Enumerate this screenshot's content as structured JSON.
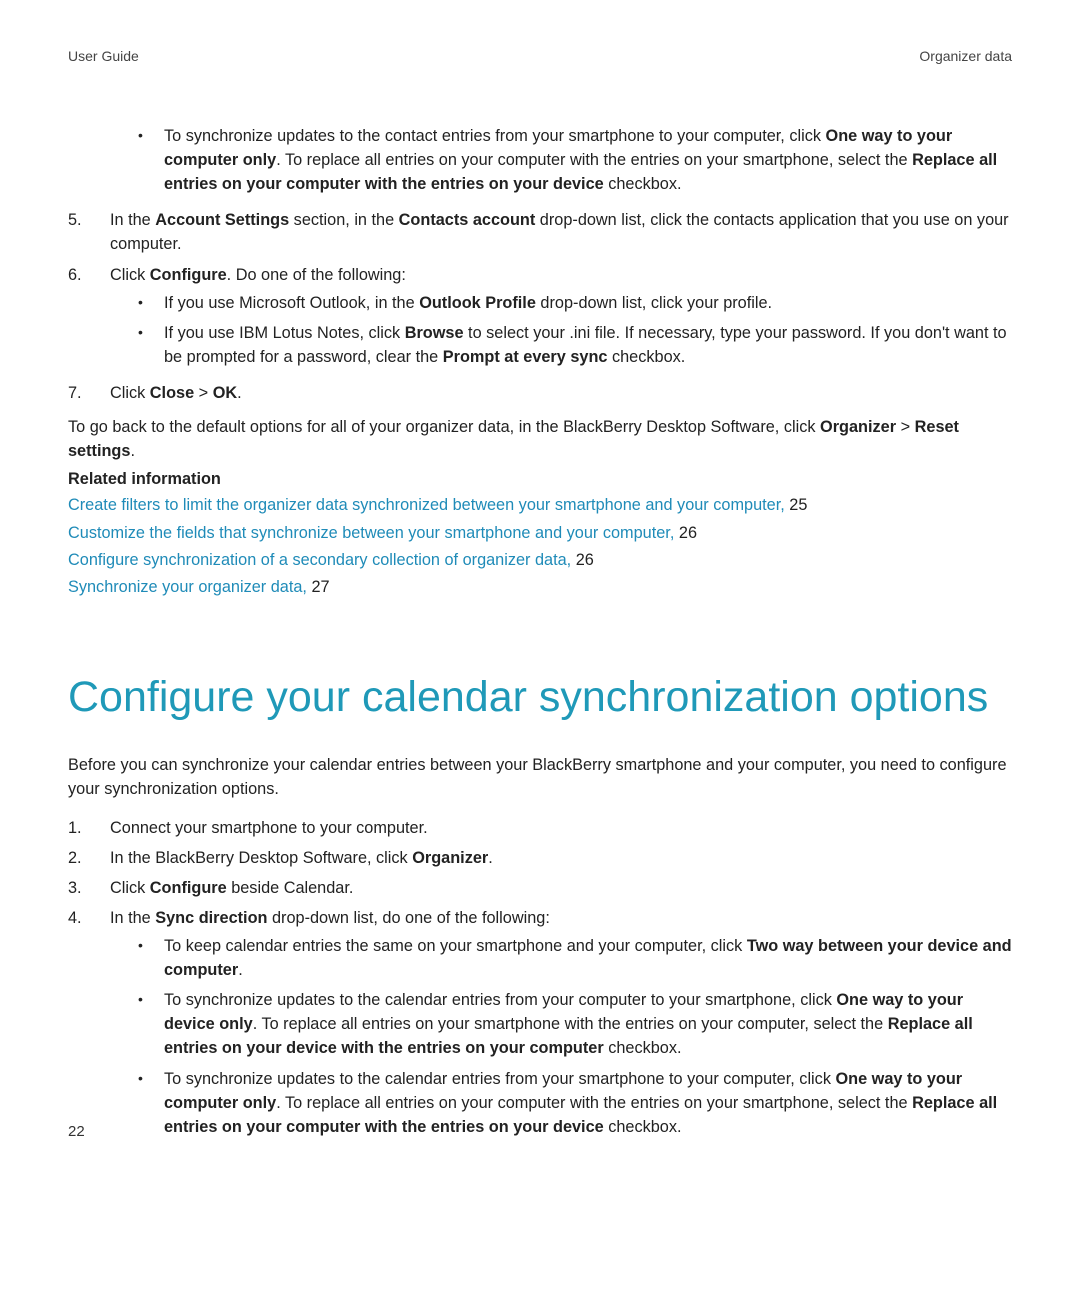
{
  "header": {
    "left": "User Guide",
    "right": "Organizer data"
  },
  "topBullet": {
    "pre": "To synchronize updates to the contact entries from your smartphone to your computer, click ",
    "b1": "One way to your computer only",
    "mid1": ". To replace all entries on your computer with the entries on your smartphone, select the ",
    "b2": "Replace all entries on your computer with the entries on your device",
    "post": " checkbox."
  },
  "step5": {
    "num": "5.",
    "pre": "In the ",
    "b1": "Account Settings",
    "mid1": " section, in the ",
    "b2": "Contacts account",
    "post": " drop-down list, click the contacts application that you use on your computer."
  },
  "step6": {
    "num": "6.",
    "pre": "Click ",
    "b1": "Configure",
    "post": ". Do one of the following:",
    "sub1": {
      "pre": "If you use Microsoft Outlook, in the ",
      "b1": "Outlook Profile",
      "post": " drop-down list, click your profile."
    },
    "sub2": {
      "pre": "If you use IBM Lotus Notes, click ",
      "b1": "Browse",
      "mid1": " to select your .ini file. If necessary, type your password. If you don't want to be prompted for a password, clear the ",
      "b2": "Prompt at every sync",
      "post": " checkbox."
    }
  },
  "step7": {
    "num": "7.",
    "pre": "Click ",
    "b1": "Close",
    "mid": " > ",
    "b2": "OK",
    "post": "."
  },
  "paraBack": {
    "pre": "To go back to the default options for all of your organizer data, in the BlackBerry Desktop Software, click ",
    "b1": "Organizer",
    "mid": " > ",
    "b2": "Reset settings",
    "post": "."
  },
  "relatedHeading": "Related information",
  "relatedLinks": [
    {
      "text": "Create filters to limit the organizer data synchronized between your smartphone and your computer,",
      "page": " 25"
    },
    {
      "text": "Customize the fields that synchronize between your smartphone and your computer,",
      "page": " 26"
    },
    {
      "text": "Configure synchronization of a secondary collection of organizer data,",
      "page": " 26"
    },
    {
      "text": "Synchronize your organizer data,",
      "page": " 27"
    }
  ],
  "sectionTitle": "Configure your calendar synchronization options",
  "intro": "Before you can synchronize your calendar entries between your BlackBerry smartphone and your computer, you need to configure your synchronization options.",
  "calStep1": {
    "num": "1.",
    "text": "Connect your smartphone to your computer."
  },
  "calStep2": {
    "num": "2.",
    "pre": "In the BlackBerry Desktop Software, click ",
    "b1": "Organizer",
    "post": "."
  },
  "calStep3": {
    "num": "3.",
    "pre": "Click ",
    "b1": "Configure",
    "post": " beside Calendar."
  },
  "calStep4": {
    "num": "4.",
    "pre": "In the ",
    "b1": "Sync direction",
    "post": " drop-down list, do one of the following:",
    "sub1": {
      "pre": "To keep calendar entries the same on your smartphone and your computer, click ",
      "b1": "Two way between your device and computer",
      "post": "."
    },
    "sub2": {
      "pre": "To synchronize updates to the calendar entries from your computer to your smartphone, click ",
      "b1": "One way to your device only",
      "mid1": ". To replace all entries on your smartphone with the entries on your computer, select the ",
      "b2": "Replace all entries on your device with the entries on your computer",
      "post": " checkbox."
    },
    "sub3": {
      "pre": "To synchronize updates to the calendar entries from your smartphone to your computer, click ",
      "b1": "One way to your computer only",
      "mid1": ". To replace all entries on your computer with the entries on your smartphone, select the ",
      "b2": "Replace all entries on your computer with the entries on your device",
      "post": " checkbox."
    }
  },
  "pageNumber": "22"
}
